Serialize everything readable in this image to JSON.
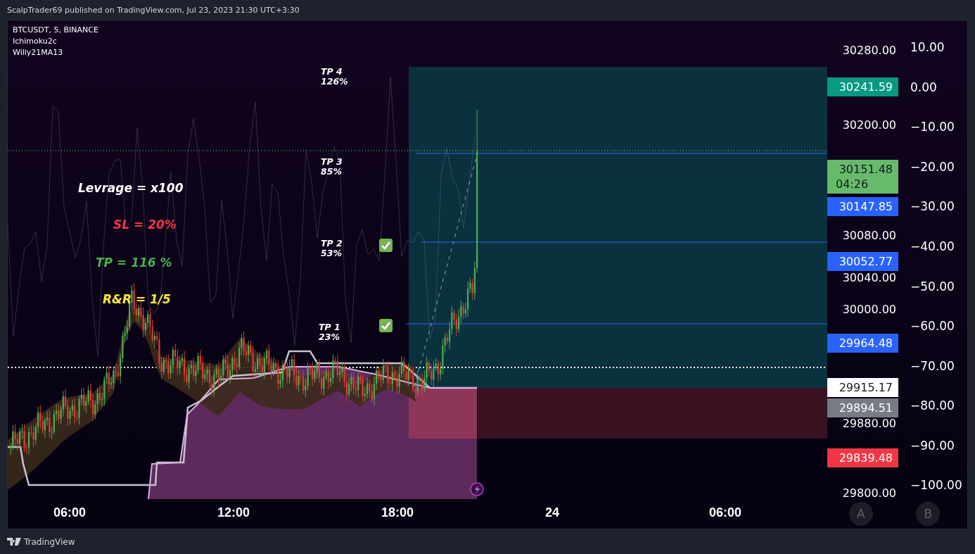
{
  "header": {
    "text": "ScalpTrader69 published on TradingView.com, Jul 23, 2023 21:30 UTC+3:30"
  },
  "legend": [
    "BTCUSDT, 5, BINANCE",
    "Ichimoku2c",
    "Willy21MA13"
  ],
  "annotations": [
    {
      "text": "Levrage = x100",
      "color": "#ffffff"
    },
    {
      "text": "SL = 20%",
      "color": "#f23645"
    },
    {
      "text": "TP = 116 %",
      "color": "#4caf50"
    },
    {
      "text": "R&R = 1/5",
      "color": "#ffeb3b"
    }
  ],
  "targets": [
    {
      "label": "TP 4",
      "percent": "126%",
      "checked": false
    },
    {
      "label": "TP 3",
      "percent": "85%",
      "checked": false
    },
    {
      "label": "TP 2",
      "percent": "53%",
      "checked": true
    },
    {
      "label": "TP 1",
      "percent": "23%",
      "checked": true
    }
  ],
  "price_axis": {
    "ticks": [
      "30280.00",
      "30200.00",
      "30080.00",
      "30040.00",
      "30000.00",
      "29880.00",
      "29800.00"
    ],
    "labels": [
      {
        "value": "30241.59",
        "color": "#089981"
      },
      {
        "value": "30151.48",
        "time": "04:26",
        "color": "#66bb6a"
      },
      {
        "value": "30147.85",
        "color": "#2962ff"
      },
      {
        "value": "30052.77",
        "color": "#2962ff"
      },
      {
        "value": "29964.48",
        "color": "#2962ff"
      },
      {
        "value": "29915.17",
        "color": "#ffffff"
      },
      {
        "value": "29894.51",
        "color": "#787b86"
      },
      {
        "value": "29839.48",
        "color": "#f23645"
      }
    ]
  },
  "oscillator_axis": {
    "ticks": [
      "10.00",
      "0.00",
      "−10.00",
      "−20.00",
      "−30.00",
      "−40.00",
      "−50.00",
      "−60.00",
      "−70.00",
      "−80.00",
      "−90.00",
      "−100.00"
    ]
  },
  "time_axis": {
    "ticks": [
      "06:00",
      "12:00",
      "18:00",
      "24",
      "06:00"
    ]
  },
  "scale_buttons": [
    "A",
    "B"
  ],
  "footer": {
    "brand": "TradingView"
  }
}
